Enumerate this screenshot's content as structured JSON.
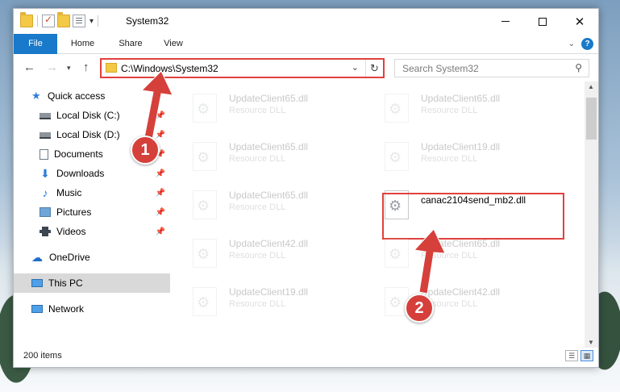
{
  "window": {
    "title": "System32",
    "controls": {
      "minimize": "—",
      "maximize": "☐",
      "close": "✕"
    }
  },
  "ribbon": {
    "tabs": [
      {
        "label": "File"
      },
      {
        "label": "Home"
      },
      {
        "label": "Share"
      },
      {
        "label": "View"
      }
    ]
  },
  "navigation": {
    "address": "C:\\Windows\\System32",
    "search_placeholder": "Search System32"
  },
  "sidebar": {
    "items": [
      {
        "label": "Quick access",
        "pinned": false
      },
      {
        "label": "Local Disk (C:)",
        "pinned": true
      },
      {
        "label": "Local Disk (D:)",
        "pinned": true
      },
      {
        "label": "Documents",
        "pinned": true
      },
      {
        "label": "Downloads",
        "pinned": true
      },
      {
        "label": "Music",
        "pinned": true
      },
      {
        "label": "Pictures",
        "pinned": true
      },
      {
        "label": "Videos",
        "pinned": true
      },
      {
        "label": "OneDrive",
        "pinned": false
      },
      {
        "label": "This PC",
        "pinned": false,
        "selected": true
      },
      {
        "label": "Network",
        "pinned": false
      }
    ]
  },
  "files": [
    {
      "name": "UpdateClient65.dll",
      "type": "Resource DLL",
      "faded": true
    },
    {
      "name": "UpdateClient65.dll",
      "type": "Resource DLL",
      "faded": true
    },
    {
      "name": "UpdateClient65.dll",
      "type": "Resource DLL",
      "faded": true
    },
    {
      "name": "UpdateClient19.dll",
      "type": "Resource DLL",
      "faded": true
    },
    {
      "name": "UpdateClient65.dll",
      "type": "Resource DLL",
      "faded": true
    },
    {
      "name": "canac2104send_mb2.dll",
      "type": "",
      "faded": false,
      "highlighted": true
    },
    {
      "name": "UpdateClient42.dll",
      "type": "Resource DLL",
      "faded": true
    },
    {
      "name": "UpdateClient65.dll",
      "type": "Resource DLL",
      "faded": true
    },
    {
      "name": "UpdateClient19.dll",
      "type": "Resource DLL",
      "faded": true
    },
    {
      "name": "UpdateClient42.dll",
      "type": "Resource DLL",
      "faded": true
    }
  ],
  "status": {
    "item_count": "200 items"
  },
  "annotations": {
    "callout_1": "1",
    "callout_2": "2",
    "accent_color": "#d6403b"
  }
}
